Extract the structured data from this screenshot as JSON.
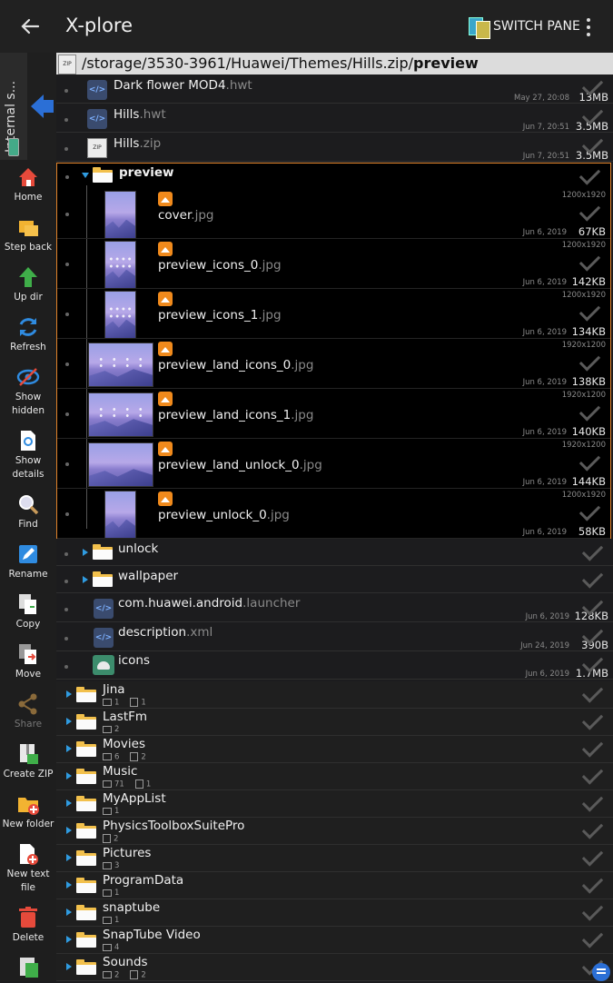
{
  "app": {
    "title": "X-plore",
    "switch_pane": "SWITCH PANE"
  },
  "storage_tab": {
    "label": "Internal s..."
  },
  "path": {
    "prefix": "/storage/3530-3961/Huawei/Themes/Hills.zip/",
    "current": "preview"
  },
  "toolbar": [
    {
      "label": "Home",
      "icon": "home-icon",
      "enabled": true
    },
    {
      "label": "Step back",
      "icon": "step-back-icon",
      "enabled": true
    },
    {
      "label": "Up dir",
      "icon": "up-dir-icon",
      "enabled": true
    },
    {
      "label": "Refresh",
      "icon": "refresh-icon",
      "enabled": true
    },
    {
      "label": "Show hidden",
      "icon": "show-hidden-icon",
      "enabled": true
    },
    {
      "label": "Show details",
      "icon": "show-details-icon",
      "enabled": true
    },
    {
      "label": "Find",
      "icon": "find-icon",
      "enabled": true
    },
    {
      "label": "Rename",
      "icon": "rename-icon",
      "enabled": true
    },
    {
      "label": "Copy",
      "icon": "copy-icon",
      "enabled": true
    },
    {
      "label": "Move",
      "icon": "move-icon",
      "enabled": true
    },
    {
      "label": "Share",
      "icon": "share-icon",
      "enabled": false
    },
    {
      "label": "Create ZIP",
      "icon": "create-zip-icon",
      "enabled": true
    },
    {
      "label": "New folder",
      "icon": "new-folder-icon",
      "enabled": true
    },
    {
      "label": "New text file",
      "icon": "new-text-file-icon",
      "enabled": true
    },
    {
      "label": "Delete",
      "icon": "delete-icon",
      "enabled": true
    }
  ],
  "upper_files": [
    {
      "name": "Dark flower MOD4",
      "ext": ".hwt",
      "date": "May 27, 20:08",
      "size": "13MB"
    },
    {
      "name": "Hills",
      "ext": ".hwt",
      "date": "Jun 7, 20:51",
      "size": "3.5MB"
    },
    {
      "name": "Hills",
      "ext": ".zip",
      "date": "Jun 7, 20:51",
      "size": "3.5MB"
    }
  ],
  "preview_folder": {
    "name": "preview"
  },
  "preview_files": [
    {
      "name": "cover",
      "ext": ".jpg",
      "res": "1200x1920",
      "date": "Jun 6, 2019",
      "size": "67KB",
      "orient": "portrait"
    },
    {
      "name": "preview_icons_0",
      "ext": ".jpg",
      "res": "1200x1920",
      "date": "Jun 6, 2019",
      "size": "142KB",
      "orient": "portrait"
    },
    {
      "name": "preview_icons_1",
      "ext": ".jpg",
      "res": "1200x1920",
      "date": "Jun 6, 2019",
      "size": "134KB",
      "orient": "portrait"
    },
    {
      "name": "preview_land_icons_0",
      "ext": ".jpg",
      "res": "1920x1200",
      "date": "Jun 6, 2019",
      "size": "138KB",
      "orient": "land"
    },
    {
      "name": "preview_land_icons_1",
      "ext": ".jpg",
      "res": "1920x1200",
      "date": "Jun 6, 2019",
      "size": "140KB",
      "orient": "land"
    },
    {
      "name": "preview_land_unlock_0",
      "ext": ".jpg",
      "res": "1920x1200",
      "date": "Jun 6, 2019",
      "size": "144KB",
      "orient": "land"
    },
    {
      "name": "preview_unlock_0",
      "ext": ".jpg",
      "res": "1200x1920",
      "date": "Jun 6, 2019",
      "size": "58KB",
      "orient": "portrait"
    }
  ],
  "zip_entries": [
    {
      "type": "folder",
      "name": "unlock"
    },
    {
      "type": "folder",
      "name": "wallpaper"
    },
    {
      "type": "code",
      "name": "com.huawei.android",
      "ext": ".launcher",
      "date": "Jun 6, 2019",
      "size": "128KB"
    },
    {
      "type": "code",
      "name": "description",
      "ext": ".xml",
      "date": "Jun 24, 2019",
      "size": "390B"
    },
    {
      "type": "android",
      "name": "icons",
      "ext": "",
      "date": "Jun 6, 2019",
      "size": "1.7MB"
    }
  ],
  "folders": [
    {
      "name": "Jina",
      "dirs": "1",
      "files": "1"
    },
    {
      "name": "LastFm",
      "dirs": "2",
      "files": ""
    },
    {
      "name": "Movies",
      "dirs": "6",
      "files": "2"
    },
    {
      "name": "Music",
      "dirs": "71",
      "files": "1"
    },
    {
      "name": "MyAppList",
      "dirs": "1",
      "files": ""
    },
    {
      "name": "PhysicsToolboxSuitePro",
      "dirs": "",
      "files": "2"
    },
    {
      "name": "Pictures",
      "dirs": "3",
      "files": ""
    },
    {
      "name": "ProgramData",
      "dirs": "1",
      "files": ""
    },
    {
      "name": "snaptube",
      "dirs": "1",
      "files": ""
    },
    {
      "name": "SnapTube Video",
      "dirs": "4",
      "files": ""
    },
    {
      "name": "Sounds",
      "dirs": "2",
      "files": "2"
    }
  ],
  "colors": {
    "accent": "#2f9be0",
    "selection_border": "#e0822a",
    "image_badge": "#f08a1c"
  }
}
